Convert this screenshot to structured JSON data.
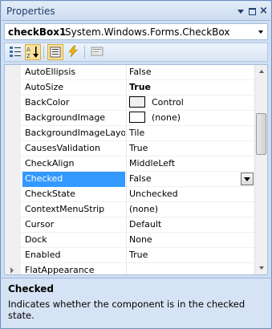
{
  "window": {
    "title": "Properties",
    "pin_icon": "dropdown-arrow-icon",
    "float_icon": "window-icon",
    "close_label": "×"
  },
  "selector": {
    "object_name": "checkBox1",
    "object_type": "System.Windows.Forms.CheckBox"
  },
  "toolbar": {
    "buttons": [
      {
        "name": "categorized-button",
        "icon": "categorized-icon",
        "active": false
      },
      {
        "name": "alphabetical-button",
        "icon": "sort-az-icon",
        "active": true
      },
      {
        "name": "properties-button",
        "icon": "properties-icon",
        "active": true
      },
      {
        "name": "events-button",
        "icon": "lightning-icon",
        "active": false
      },
      {
        "name": "property-pages-button",
        "icon": "property-pages-icon",
        "active": false
      }
    ]
  },
  "grid": {
    "rows": [
      {
        "name": "AutoEllipsis",
        "value": "False"
      },
      {
        "name": "AutoSize",
        "value": "True",
        "bold": true
      },
      {
        "name": "BackColor",
        "value": "Control",
        "swatch": "#f0f0f0"
      },
      {
        "name": "BackgroundImage",
        "value": "(none)",
        "swatch": "#ffffff"
      },
      {
        "name": "BackgroundImageLayout",
        "value": "Tile"
      },
      {
        "name": "CausesValidation",
        "value": "True"
      },
      {
        "name": "CheckAlign",
        "value": "MiddleLeft"
      },
      {
        "name": "Checked",
        "value": "False",
        "selected": true
      },
      {
        "name": "CheckState",
        "value": "Unchecked"
      },
      {
        "name": "ContextMenuStrip",
        "value": "(none)"
      },
      {
        "name": "Cursor",
        "value": "Default"
      },
      {
        "name": "Dock",
        "value": "None"
      },
      {
        "name": "Enabled",
        "value": "True"
      },
      {
        "name": "FlatAppearance",
        "value": "",
        "expandable": true
      }
    ]
  },
  "description": {
    "title": "Checked",
    "text": "Indicates whether the component is in the checked state."
  },
  "colors": {
    "selection": "#3399ff",
    "frame": "#cfdff3"
  }
}
